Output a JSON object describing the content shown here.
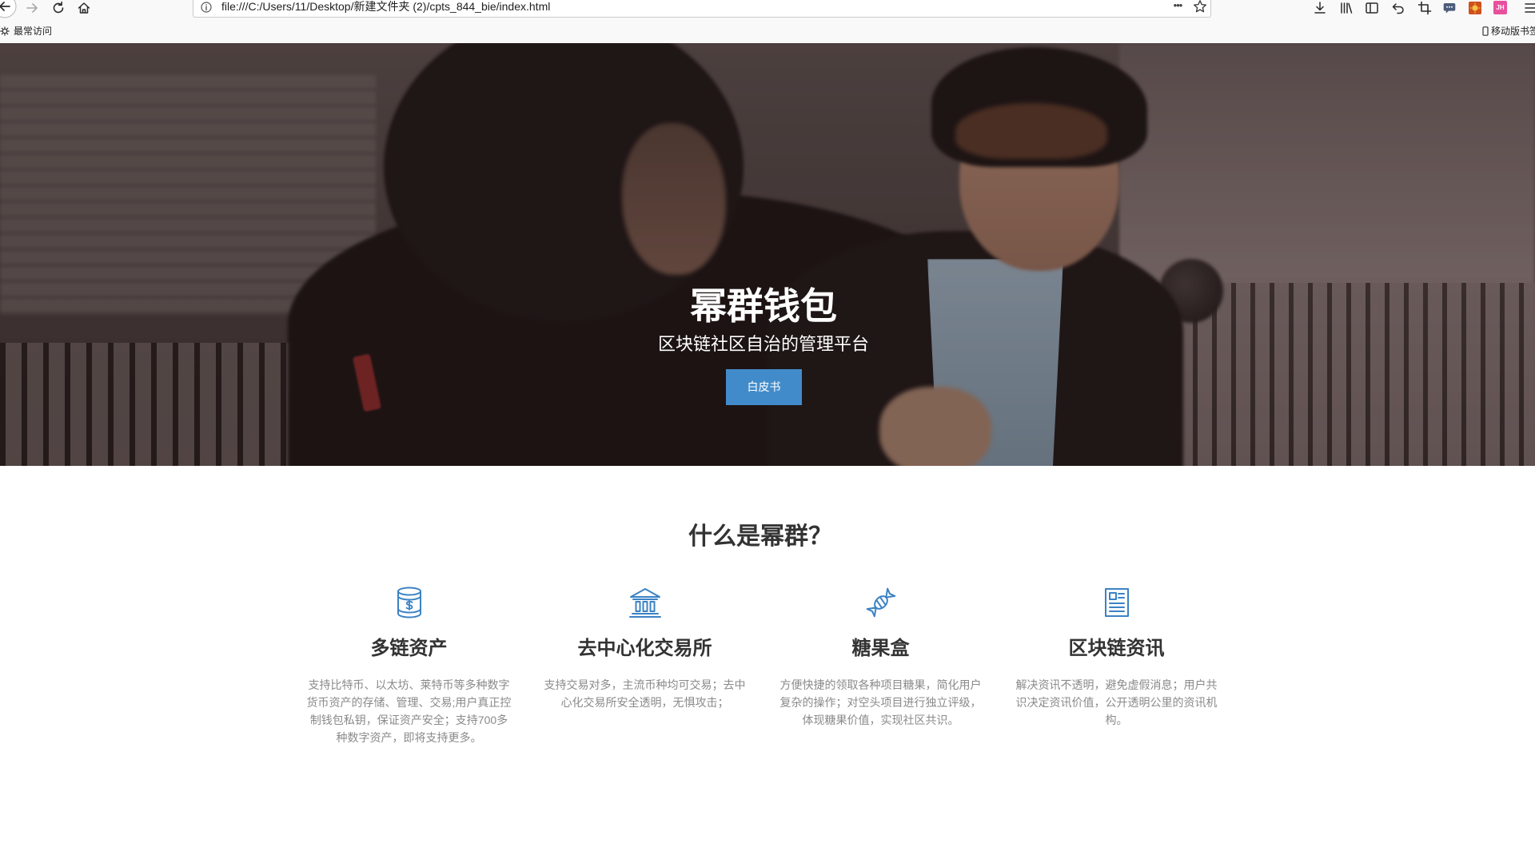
{
  "browser": {
    "url": "file:///C:/Users/11/Desktop/新建文件夹 (2)/cpts_844_bie/index.html",
    "page_actions_label": "•••",
    "profile_badge": "JH",
    "bookmarks_bar": {
      "most_visited": "最常访问",
      "mobile_bookmarks": "移动版书签"
    },
    "nav_icons": [
      "back-icon",
      "forward-icon",
      "reload-icon",
      "home-icon"
    ],
    "url_icons": [
      "info-icon",
      "star-icon"
    ],
    "toolbar_icons": [
      "download-icon",
      "library-icon",
      "sidebar-icon",
      "undo-icon",
      "crop-icon",
      "chat-icon",
      "extension-icon",
      "profile-icon",
      "menu-icon"
    ]
  },
  "hero": {
    "title": "幂群钱包",
    "subtitle": "区块链社区自治的管理平台",
    "button_label": "白皮书"
  },
  "about": {
    "title": "什么是幂群？",
    "features": [
      {
        "icon": "coins-icon",
        "title": "多链资产",
        "description_lines": [
          "支持比特币、以太坊、莱特币等多种数字",
          "货币资产的存储、管理、交易;用户真正控",
          "制钱包私钥，保证资产安全；支持700多",
          "种数字资产，即将支持更多。"
        ]
      },
      {
        "icon": "bank-icon",
        "title": "去中心化交易所",
        "description_lines": [
          "支持交易对多，主流币种均可交易；去中",
          "心化交易所安全透明，无惧攻击；"
        ]
      },
      {
        "icon": "candy-icon",
        "title": "糖果盒",
        "description_lines": [
          "方便快捷的领取各种项目糖果，简化用户",
          "复杂的操作；对空头项目进行独立评级，",
          "体现糖果价值，实现社区共识。"
        ]
      },
      {
        "icon": "newspaper-icon",
        "title": "区块链资讯",
        "description_lines": [
          "解决资讯不透明，避免虚假消息；用户共",
          "识决定资讯价值，公开透明公里的资讯机",
          "构。"
        ]
      }
    ]
  },
  "colors": {
    "accent": "#3b82c4",
    "button_bg": "#428bca",
    "muted_text": "#8a8a8a",
    "heading": "#333333",
    "chrome_bg": "#f9f9fa"
  }
}
